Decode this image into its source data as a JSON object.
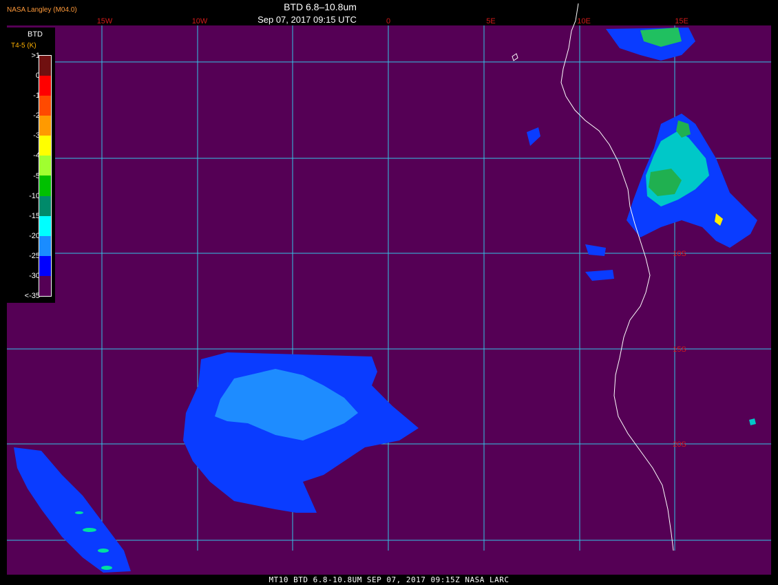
{
  "header": {
    "organization": "NASA Langley (M04.0)",
    "title": "BTD 6.8–10.8um",
    "timestamp": "Sep 07, 2017 09:15 UTC"
  },
  "footer": {
    "caption": "MT10   BTD 6.8-10.8UM   SEP 07, 2017 09:15Z   NASA LARC"
  },
  "legend": {
    "title": "BTD",
    "subtitle": "T4-5 (K)",
    "labels": [
      ">1",
      "0",
      "-1",
      "-2",
      "-3",
      "-4",
      "-5",
      "-10",
      "-15",
      "-20",
      "-25",
      "-30",
      "<-35"
    ],
    "colors": [
      "#701010",
      "#ff0000",
      "#ff4a00",
      "#ff9a00",
      "#ffff00",
      "#a0ff30",
      "#00c000",
      "#008a6a",
      "#00ffff",
      "#1a8cff",
      "#0000ff",
      "#550055"
    ]
  },
  "grid": {
    "lon_labels": [
      "15W",
      "10W",
      "0",
      "5E",
      "10E",
      "15E"
    ],
    "lat_labels": [
      "10S",
      "15S",
      "20S"
    ]
  },
  "colors": {
    "ocean": "#550055",
    "grid": "#33c6e6",
    "grid_label": "#d21a1a",
    "coastline": "#ffffff"
  }
}
